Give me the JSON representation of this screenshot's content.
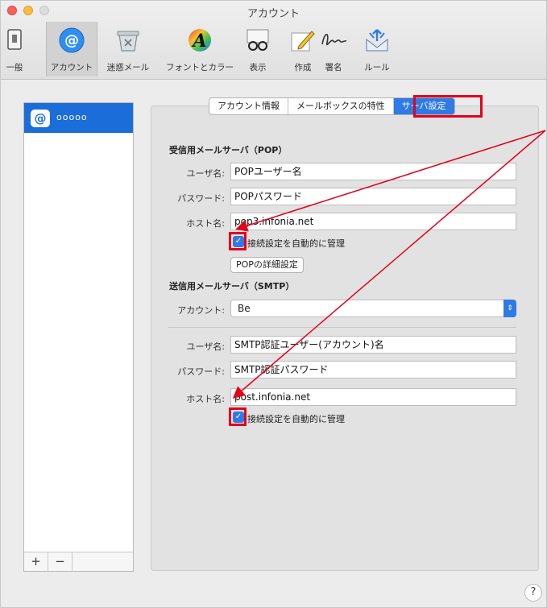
{
  "window": {
    "title": "アカウント"
  },
  "toolbar": {
    "items": [
      {
        "label": "一般",
        "icon": "switch-icon"
      },
      {
        "label": "アカウント",
        "icon": "at-icon"
      },
      {
        "label": "迷惑メール",
        "icon": "junk-icon"
      },
      {
        "label": "フォントとカラー",
        "icon": "fonts-icon"
      },
      {
        "label": "表示",
        "icon": "glasses-icon"
      },
      {
        "label": "作成",
        "icon": "pencil-icon"
      },
      {
        "label": "署名",
        "icon": "signature-icon"
      },
      {
        "label": "ルール",
        "icon": "rules-icon"
      }
    ]
  },
  "sidebar": {
    "account_badge": "@",
    "account_name": "ooooo",
    "add": "+",
    "remove": "−"
  },
  "tabs": [
    "アカウント情報",
    "メールボックスの特性",
    "サーバ設定"
  ],
  "incoming": {
    "title": "受信用メールサーバ（POP）",
    "user_label": "ユーザ名:",
    "user_value": "POPユーザー名",
    "pass_label": "パスワード:",
    "pass_value": "POPパスワード",
    "host_label": "ホスト名:",
    "host_value": "pop3.infonia.net",
    "auto_label": "接続設定を自動的に管理",
    "advanced_button": "POPの詳細設定"
  },
  "outgoing": {
    "title": "送信用メールサーバ（SMTP）",
    "account_label": "アカウント:",
    "account_value": "Be",
    "user_label": "ユーザ名:",
    "user_value": "SMTP認証ユーザー(アカウント)名",
    "pass_label": "パスワード:",
    "pass_value": "SMTP認証パスワード",
    "host_label": "ホスト名:",
    "host_value": "post.infonia.net",
    "auto_label": "接続設定を自動的に管理"
  },
  "help": "?",
  "colors": {
    "accent": "#2f7ae5",
    "selection": "#1b6dd9",
    "annotation": "#e3001b"
  }
}
